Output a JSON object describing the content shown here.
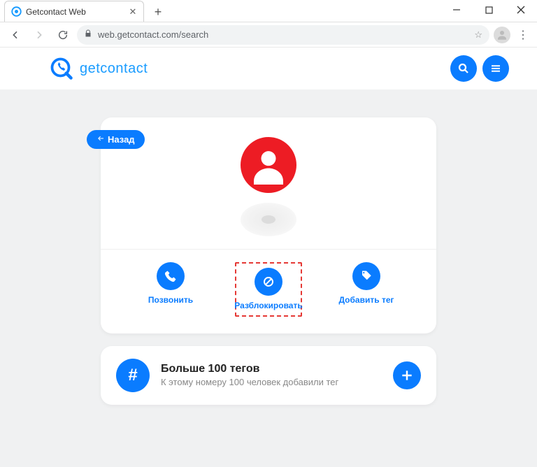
{
  "browser": {
    "tab_title": "Getcontact Web",
    "url": "web.getcontact.com/search"
  },
  "header": {
    "brand": "getcontact"
  },
  "back_label": "Назад",
  "actions": {
    "call": "Позвонить",
    "unblock": "Разблокировать",
    "addtag": "Добавить тег"
  },
  "tags": {
    "title": "Больше 100 тегов",
    "subtitle": "К этому номеру 100 человек добавили тег"
  }
}
